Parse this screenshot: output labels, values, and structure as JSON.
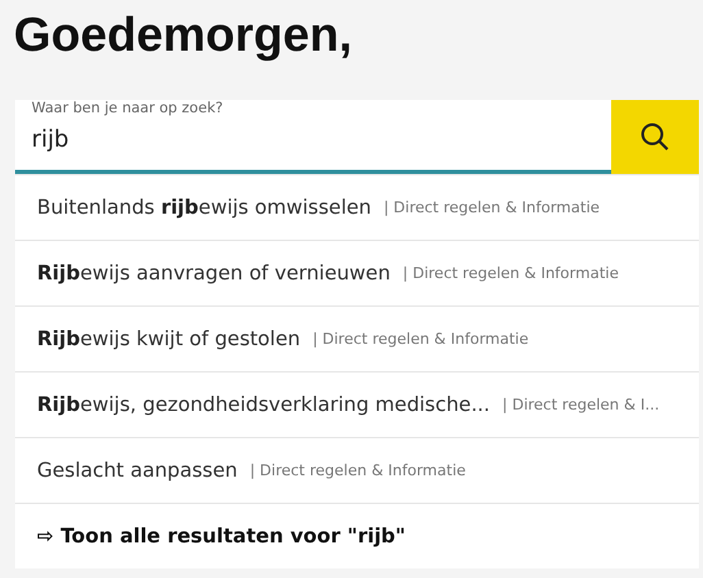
{
  "heading": "Goedemorgen,",
  "search": {
    "label": "Waar ben je naar op zoek?",
    "value": "rijb"
  },
  "suggestions": [
    {
      "title": "Buitenlands **rijb**ewijs omwisselen",
      "category": "| Direct regelen & Informatie"
    },
    {
      "title": "**Rijb**ewijs aanvragen of vernieuwen",
      "category": "| Direct regelen & Informatie"
    },
    {
      "title": "**Rijb**ewijs kwijt of gestolen",
      "category": "| Direct regelen & Informatie"
    },
    {
      "title": "**Rijb**ewijs, gezondheidsverklaring medische...",
      "category": "| Direct regelen & I..."
    },
    {
      "title": "Geslacht aanpassen",
      "category": "| Direct regelen & Informatie"
    }
  ],
  "show_all": "⇨ Toon alle resultaten voor \"rijb\""
}
